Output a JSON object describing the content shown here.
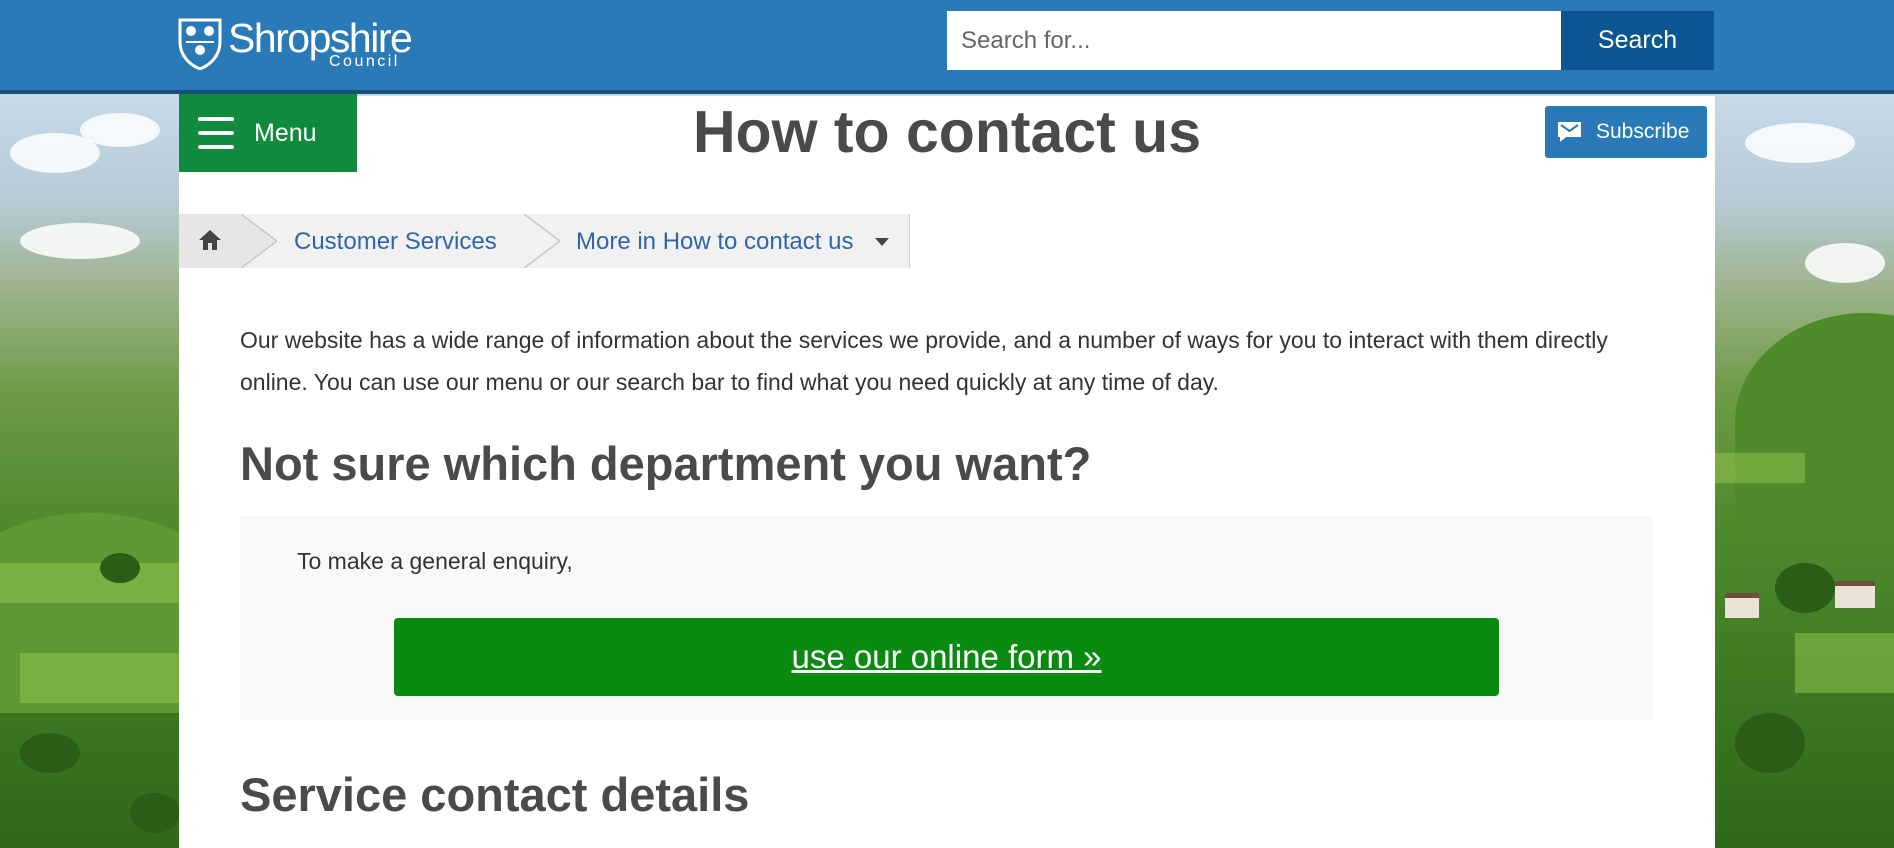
{
  "header": {
    "logo_main": "Shropshire",
    "logo_sub": "Council",
    "search_placeholder": "Search for...",
    "search_button": "Search"
  },
  "menu": {
    "label": "Menu"
  },
  "page": {
    "title": "How to contact us",
    "subscribe_label": "Subscribe"
  },
  "breadcrumb": {
    "home_icon": "home-icon",
    "items": [
      "Customer Services",
      "More in How to contact us"
    ]
  },
  "content": {
    "intro": "Our website has a wide range of information about the services we provide, and a number of ways for you to interact with them directly online. You can use our menu or our search bar to find what you need quickly at any time of day.",
    "heading_1": "Not sure which department you want?",
    "enquiry_text": "To make a general enquiry,",
    "form_link": "use our online form »",
    "heading_2": "Service contact details"
  },
  "colors": {
    "header_blue": "#2a7ab8",
    "search_button": "#0b5690",
    "menu_green": "#108a3c",
    "form_button_green": "#0a8a11",
    "link_blue": "#2f66a8",
    "heading_grey": "#4a4a4a"
  }
}
